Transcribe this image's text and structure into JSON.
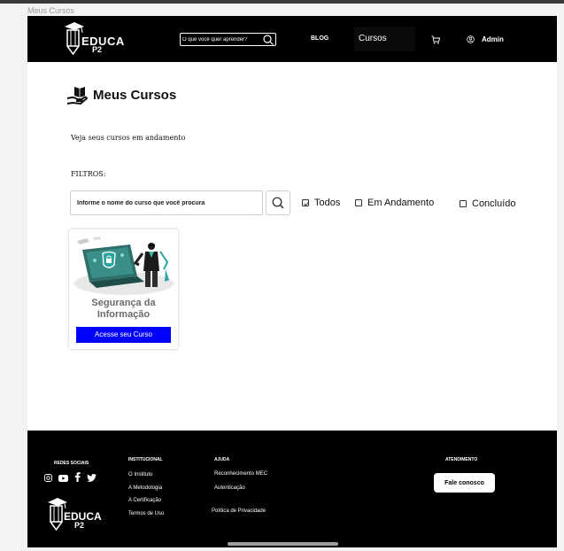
{
  "frame_label": "Meus Cursos",
  "header": {
    "logo_line1": "EDUCA",
    "logo_line2": "P2",
    "search_placeholder": "O que você quer aprender?",
    "nav_blog": "BLOG",
    "nav_cursos": "Cursos",
    "user_label": "Admin"
  },
  "main": {
    "title": "Meus Cursos",
    "subtitle": "Veja seus cursos em andamento",
    "filters_label": "FILTROS:",
    "search_placeholder": "Informe o nome do curso que você procura",
    "filters": [
      {
        "label": "Todos",
        "checked": true
      },
      {
        "label": "Em Andamento",
        "checked": false
      },
      {
        "label": "Concluído",
        "checked": false
      }
    ]
  },
  "courses": [
    {
      "title": "Segurança da\nInformação",
      "button": "Acesse seu Curso"
    }
  ],
  "footer": {
    "social_label": "REDES SOCIAIS",
    "social_icons": [
      "instagram-icon",
      "youtube-icon",
      "facebook-icon",
      "twitter-icon"
    ],
    "institucional_label": "INSTITUCIONAL",
    "institucional_links": [
      "O Instituto",
      "A Metodologia",
      "A Certificação",
      "Termos de Uso"
    ],
    "ajuda_label": "AJUDA",
    "ajuda_links": [
      "Reconhecimento MEC",
      "Autenticação",
      "Política de Privacidade"
    ],
    "atendimento_label": "ATENDIMENTO",
    "contact_button": "Fale conosco",
    "logo_line1": "EDUCA",
    "logo_line2": "P2"
  },
  "colors": {
    "accent": "#0000ff",
    "header_bg": "#000000",
    "card_title": "#6b6b6b"
  }
}
